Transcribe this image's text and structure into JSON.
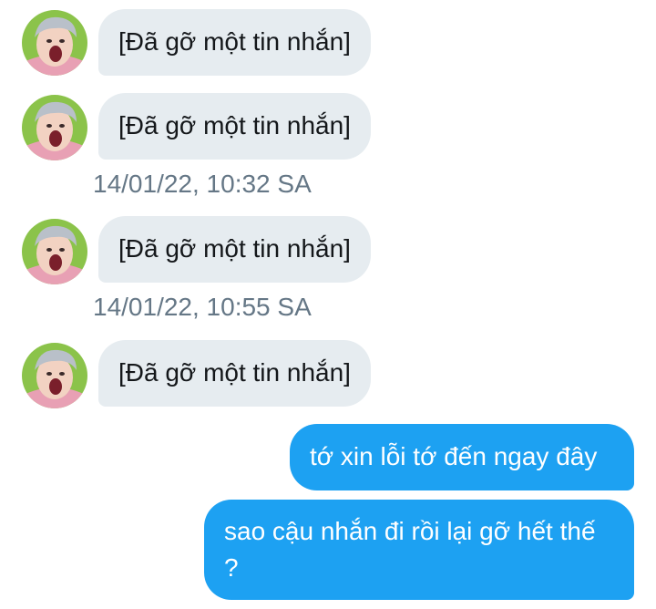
{
  "conversation": {
    "incoming_messages": [
      {
        "text": "[Đã gỡ một tin nhắn]"
      },
      {
        "text": "[Đã gỡ một tin nhắn]",
        "timestamp": "14/01/22, 10:32 SA"
      },
      {
        "text": "[Đã gỡ một tin nhắn]",
        "timestamp": "14/01/22, 10:55 SA"
      },
      {
        "text": "[Đã gỡ một tin nhắn]"
      }
    ],
    "outgoing_messages": [
      {
        "text": "tớ xin lỗi tớ đến ngay đây"
      },
      {
        "text": "sao cậu nhắn đi rồi lại gỡ hết thế ?"
      }
    ]
  },
  "colors": {
    "incoming_bubble": "#e6ecf0",
    "outgoing_bubble": "#1da1f2",
    "timestamp_text": "#657786"
  }
}
